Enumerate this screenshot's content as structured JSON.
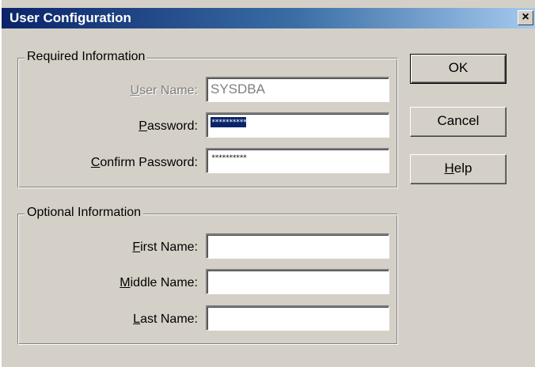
{
  "window": {
    "title": "User Configuration",
    "close_glyph": "×"
  },
  "required": {
    "legend": "Required Information",
    "user_name": {
      "label_key": "U",
      "label_rest": "ser Name:",
      "value": "SYSDBA"
    },
    "password": {
      "label_key": "P",
      "label_rest": "assword:",
      "value": "**********"
    },
    "confirm_password": {
      "label_key": "C",
      "label_rest": "onfirm Password:",
      "value": "**********"
    }
  },
  "optional": {
    "legend": "Optional Information",
    "first_name": {
      "label_key": "F",
      "label_rest": "irst Name:",
      "value": ""
    },
    "middle_name": {
      "label_key": "M",
      "label_rest": "iddle Name:",
      "value": ""
    },
    "last_name": {
      "label_key": "L",
      "label_rest": "ast Name:",
      "value": ""
    }
  },
  "buttons": {
    "ok": "OK",
    "cancel": "Cancel",
    "help_key": "H",
    "help_rest": "elp"
  },
  "colors": {
    "dialog_bg": "#d4d0c8",
    "title_bar": "#0a246a",
    "selection": "#0a246a",
    "disabled_text": "#808080"
  }
}
